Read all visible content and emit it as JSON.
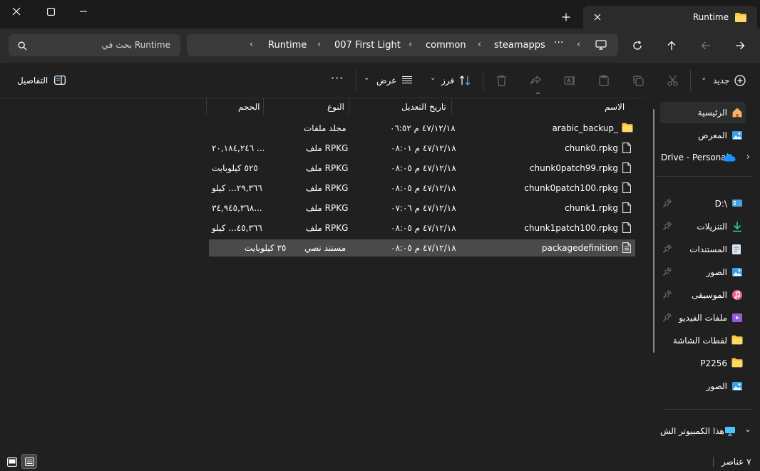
{
  "window": {
    "tab_title": "Runtime"
  },
  "search": {
    "placeholder": "بحث في Runtime"
  },
  "breadcrumb": [
    "Runtime",
    "007 First Light",
    "common",
    "steamapps"
  ],
  "toolbar": {
    "new_label": "جديد",
    "sort_label": "فرز",
    "view_label": "عرض",
    "details_label": "التفاصيل"
  },
  "columns": {
    "name": "الاسم",
    "date": "تاريخ التعديل",
    "type": "النوع",
    "size": "الحجم"
  },
  "files": [
    {
      "name": "arabic_backup_",
      "date": "٤٧/١٢/١٨ م ٠٦:٥٢",
      "type": "مجلد ملفات",
      "size": "",
      "icon": "folder-icon"
    },
    {
      "name": "chunk0.rpkg",
      "date": "٤٧/١٢/١٨ م ٠٨:٠١",
      "type": "ملف RPKG",
      "size": "٢٠,١٨٤,٢٤٦ ...",
      "icon": "file-icon"
    },
    {
      "name": "chunk0patch99.rpkg",
      "date": "٤٧/١٢/١٨ م ٠٨:٠٥",
      "type": "ملف RPKG",
      "size": "٥٢٥ كيلوبايت",
      "icon": "file-icon"
    },
    {
      "name": "chunk0patch100.rpkg",
      "date": "٤٧/١٢/١٨ م ٠٨:٠٥",
      "type": "ملف RPKG",
      "size": "٢٩,٣٦٦... كيلو",
      "icon": "file-icon"
    },
    {
      "name": "chunk1.rpkg",
      "date": "٤٧/١٢/١٨ م ٠٧:٠٦",
      "type": "ملف RPKG",
      "size": "٣٤,٩٤٥,٣٦٨...",
      "icon": "file-icon"
    },
    {
      "name": "chunk1patch100.rpkg",
      "date": "٤٧/١٢/١٨ م ٠٨:٠٥",
      "type": "ملف RPKG",
      "size": "٤٥,٣٦٦... كيلو",
      "icon": "file-icon"
    },
    {
      "name": "packagedefinition",
      "date": "٤٧/١٢/١٨ م ٠٨:٠٥",
      "type": "مستند نصي",
      "size": "٣٥ كيلوبايت",
      "icon": "text-file-icon",
      "selected": true
    }
  ],
  "nav": {
    "home": "الرئيسية",
    "gallery": "المعرض",
    "onedrive": "Drive - Personal",
    "quick": [
      {
        "label": "D:\\",
        "icon": "drive-icon"
      },
      {
        "label": "التنزيلات",
        "icon": "download-icon"
      },
      {
        "label": "المستندات",
        "icon": "documents-icon"
      },
      {
        "label": "الصور",
        "icon": "pictures-icon"
      },
      {
        "label": "الموسيقى",
        "icon": "music-icon"
      },
      {
        "label": "ملفات الفيديو",
        "icon": "video-icon"
      },
      {
        "label": "لقطات الشاشة",
        "icon": "folder-icon"
      },
      {
        "label": "P2256",
        "icon": "folder-icon"
      },
      {
        "label": "الصور",
        "icon": "pictures-icon"
      }
    ],
    "this_pc": "هذا الكمبيوتر الش"
  },
  "status": {
    "count": "٧ عناصر"
  },
  "colors": {
    "folder": "#f7c948",
    "accent": "#4cc2ff",
    "selection": "#4a4a4a"
  }
}
